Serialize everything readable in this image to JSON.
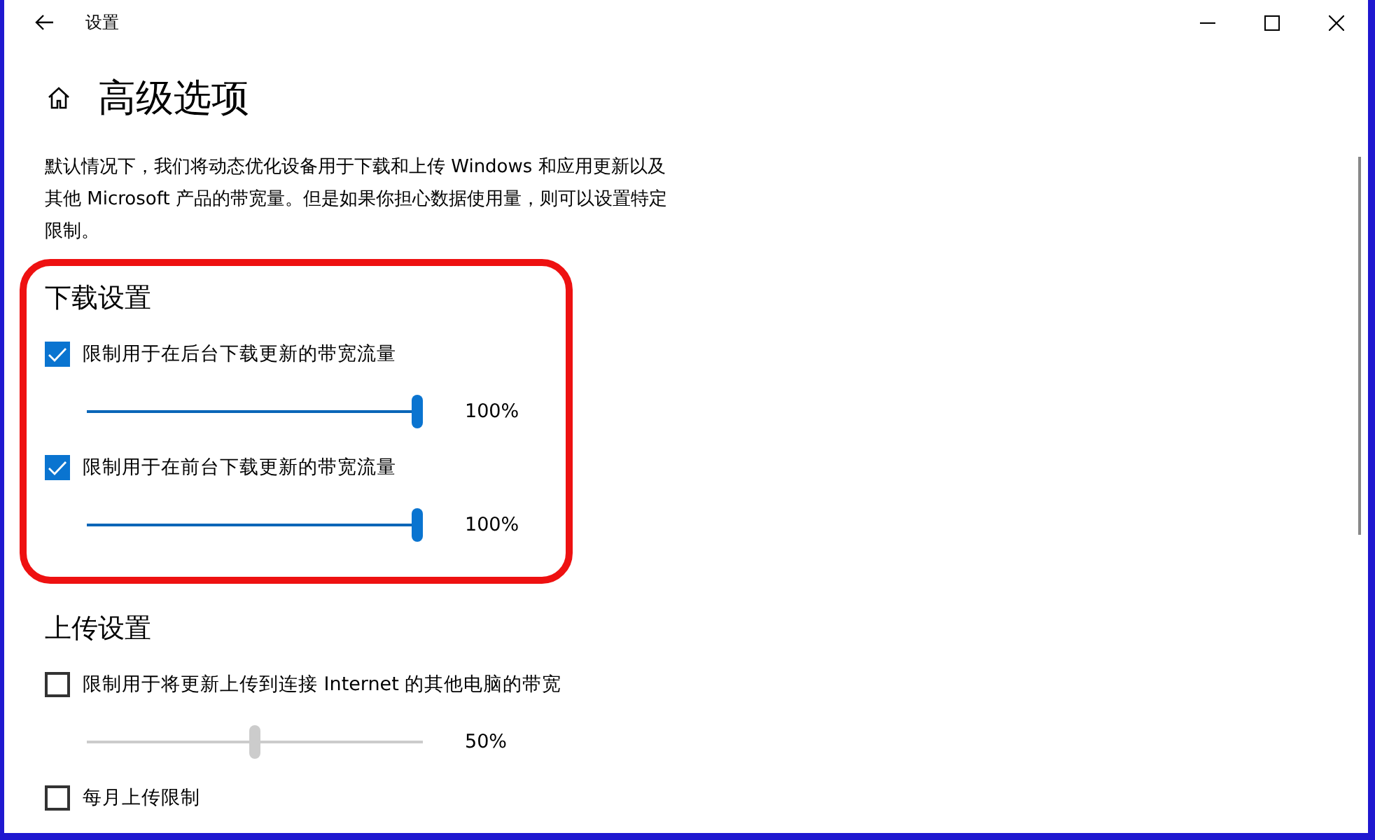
{
  "window": {
    "title": "设置"
  },
  "page": {
    "title": "高级选项",
    "description": "默认情况下，我们将动态优化设备用于下载和上传 Windows 和应用更新以及其他 Microsoft 产品的带宽量。但是如果你担心数据使用量，则可以设置特定限制。"
  },
  "sections": [
    {
      "title": "下载设置",
      "highlighted": true,
      "items": [
        {
          "kind": "checkbox",
          "label": "限制用于在后台下载更新的带宽流量",
          "checked": true
        },
        {
          "kind": "slider",
          "level": 1,
          "reading": "100%",
          "disabled": false
        },
        {
          "kind": "checkbox",
          "label": "限制用于在前台下载更新的带宽流量",
          "checked": true
        },
        {
          "kind": "slider",
          "level": 1,
          "reading": "100%",
          "disabled": false
        }
      ]
    },
    {
      "title": "上传设置",
      "highlighted": false,
      "items": [
        {
          "kind": "checkbox",
          "label": "限制用于将更新上传到连接 Internet 的其他电脑的带宽",
          "checked": false
        },
        {
          "kind": "slider",
          "level": 0.5,
          "reading": "50%",
          "disabled": true
        },
        {
          "kind": "checkbox",
          "label": "每月上传限制",
          "checked": false
        }
      ]
    }
  ]
}
